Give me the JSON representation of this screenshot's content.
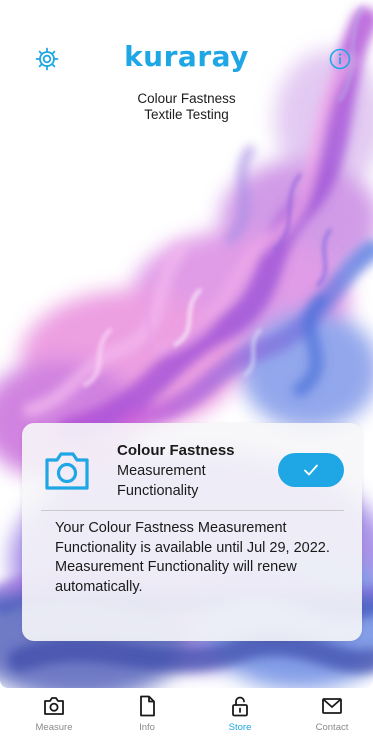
{
  "header": {
    "brand": "kuraray",
    "subtitle_line1": "Colour Fastness",
    "subtitle_line2": "Textile Testing",
    "settings_icon": "gear-icon",
    "info_icon": "info-circle-icon"
  },
  "card": {
    "icon": "camera-icon",
    "title": "Colour Fastness",
    "subtitle": "Measurement Functionality",
    "toggle_state": "active",
    "toggle_icon": "checkmark-icon",
    "availability_text": "Your Colour Fastness Measurement Functionality is available until Jul 29, 2022.",
    "renewal_text": "Measurement Functionality will renew automatically."
  },
  "tabs": [
    {
      "label": "Measure",
      "icon": "camera-icon",
      "active": false
    },
    {
      "label": "Info",
      "icon": "document-icon",
      "active": false
    },
    {
      "label": "Store",
      "icon": "lock-icon",
      "active": true
    },
    {
      "label": "Contact",
      "icon": "envelope-icon",
      "active": false
    }
  ],
  "colors": {
    "accent": "#1ea7e4",
    "tab_inactive": "#8a8a8a",
    "text": "#1a1a1a",
    "card_background": "#f6f6f8"
  }
}
